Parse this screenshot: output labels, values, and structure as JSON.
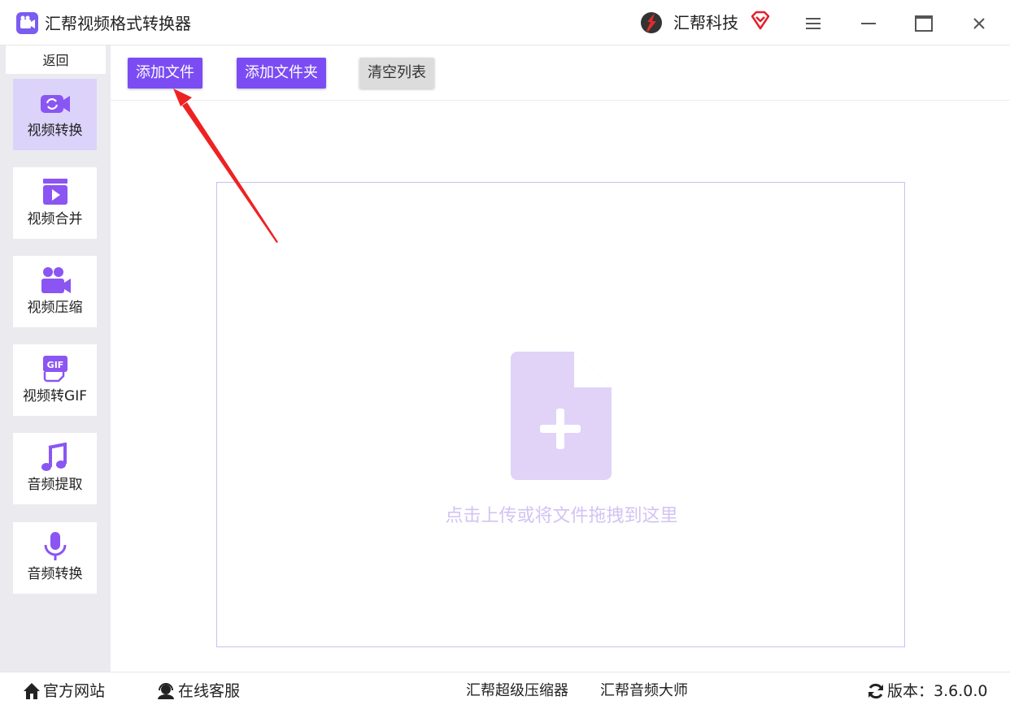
{
  "app": {
    "title": "汇帮视频格式转换器",
    "brand_name": "汇帮科技",
    "accent_color": "#7b4cf3"
  },
  "window_controls": {
    "menu_icon": "hamburger-menu-icon",
    "minimize_icon": "minimize-icon",
    "maximize_icon": "maximize-icon",
    "close_icon": "close-icon"
  },
  "sidebar": {
    "back_label": "返回",
    "items": [
      {
        "label": "视频转换",
        "icon": "video-convert-icon",
        "active": true
      },
      {
        "label": "视频合并",
        "icon": "video-merge-icon",
        "active": false
      },
      {
        "label": "视频压缩",
        "icon": "video-compress-icon",
        "active": false
      },
      {
        "label": "视频转GIF",
        "icon": "gif-icon",
        "active": false
      },
      {
        "label": "音频提取",
        "icon": "music-note-icon",
        "active": false
      },
      {
        "label": "音频转换",
        "icon": "microphone-icon",
        "active": false
      }
    ]
  },
  "toolbar": {
    "add_file": "添加文件",
    "add_folder": "添加文件夹",
    "clear_list": "清空列表"
  },
  "dropzone": {
    "hint": "点击上传或将文件拖拽到这里",
    "icon": "file-add-icon"
  },
  "footer": {
    "website": "官方网站",
    "support": "在线客服",
    "compressor": "汇帮超级压缩器",
    "audio_master": "汇帮音频大师",
    "version": "版本：3.6.0.0"
  }
}
